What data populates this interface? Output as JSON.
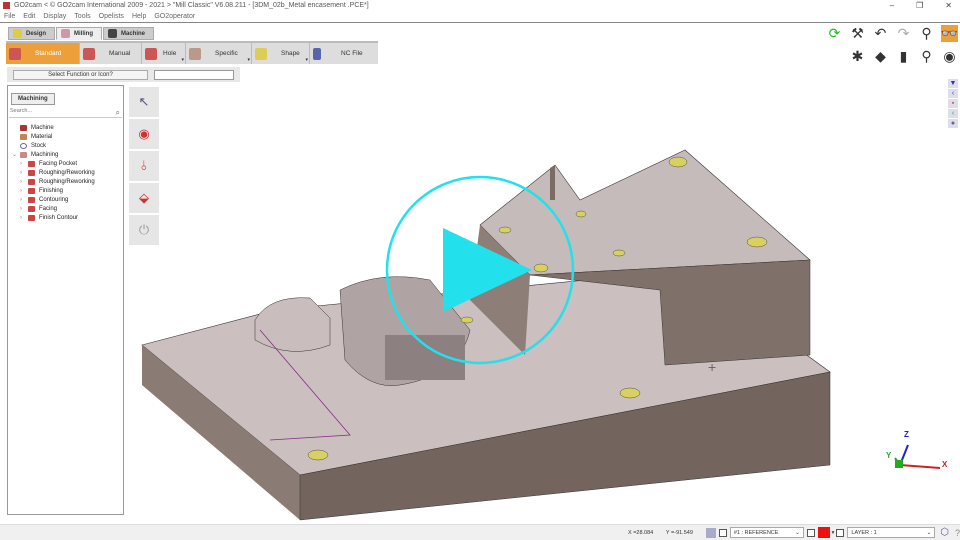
{
  "window": {
    "title": "GO2cam < © GO2cam International 2009 - 2021 >     \"Mill Classic\"   V6.08.211 - [3DM_02b_Metal encasement .PCE*]",
    "controls": [
      "–",
      "❐",
      "✕"
    ]
  },
  "menu": [
    "File",
    "Edit",
    "Display",
    "Tools",
    "Opelists",
    "Help",
    "GO2operator"
  ],
  "tabs": [
    {
      "label": "Design"
    },
    {
      "label": "Milling",
      "active": true
    },
    {
      "label": "Machine"
    }
  ],
  "ribbon": [
    {
      "label": "Standard",
      "active": true
    },
    {
      "label": "Manual"
    },
    {
      "label": "Hole",
      "dropdown": true
    },
    {
      "label": "Specific",
      "dropdown": true
    },
    {
      "label": "Shape",
      "dropdown": true
    },
    {
      "label": "NC File"
    }
  ],
  "select_function": {
    "label": "Select Function or Icon?",
    "value": ""
  },
  "panel": {
    "tab": "Machining",
    "search_placeholder": "Search...",
    "tree": [
      {
        "label": "Machine",
        "color": "#a33"
      },
      {
        "label": "Material",
        "color": "#b85"
      },
      {
        "label": "Stock",
        "color": "#88c"
      },
      {
        "label": "Machining",
        "expanded": true,
        "color": "#c88"
      },
      {
        "label": "Facing Pocket",
        "child": true
      },
      {
        "label": "Roughing/Reworking",
        "child": true
      },
      {
        "label": "Roughing/Reworking",
        "child": true
      },
      {
        "label": "Finishing",
        "child": true
      },
      {
        "label": "Contouring",
        "child": true
      },
      {
        "label": "Facing",
        "child": true
      },
      {
        "label": "Finish Contour",
        "child": true
      }
    ]
  },
  "side_tools": [
    "select-arrow-icon",
    "pocket-icon",
    "drill-icon",
    "surface-icon",
    "power-icon"
  ],
  "view_tools_row1": [
    "refresh-icon",
    "caliper-icon",
    "undo-icon",
    "redo-icon",
    "zoom-icon",
    "glasses-icon"
  ],
  "view_tools_row2": [
    "explode-icon",
    "eraser-icon",
    "magic-hat-icon",
    "zoom-fit-icon",
    "eye-rotate-icon"
  ],
  "status": {
    "x": "X =28.084",
    "y": "Y =-91.549",
    "reference": "#1 : REFERENCE",
    "layer": "LAYER : 1",
    "color": "#ee1111"
  },
  "axes": {
    "x": "X",
    "y": "Y",
    "z": "Z"
  },
  "colors": {
    "accent": "#eda03a",
    "play": "#22e0ec",
    "part_top": "#c8bcbc",
    "part_side": "#7e7068",
    "hole": "#d8d060"
  }
}
